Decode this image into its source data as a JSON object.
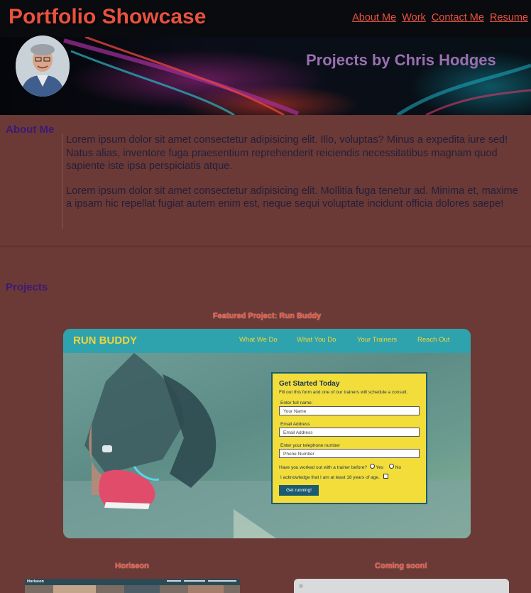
{
  "header": {
    "site_title": "Portfolio Showcase",
    "nav": [
      "About Me",
      "Work",
      "Contact Me",
      "Resume"
    ]
  },
  "hero": {
    "title": "Projects by Chris Hodges"
  },
  "about": {
    "heading": "About Me",
    "paragraphs": [
      "Lorem ipsum dolor sit amet consectetur adipisicing elit. Illo, voluptas? Minus a expedita iure sed! Natus alias, inventore fuga praesentium reprehenderit reiciendis necessitatibus magnam quod sapiente iste ipsa perspiciatis atque.",
      "Lorem ipsum dolor sit amet consectetur adipisicing elit. Mollitia fuga tenetur ad. Minima et, maxime a ipsam hic repellat fugiat autem enim est, neque sequi voluptate incidunt officia dolores saepe!"
    ]
  },
  "projects": {
    "heading": "Projects",
    "featured": {
      "caption": "Featured Project: Run Buddy",
      "logo": "RUN BUDDY",
      "nav": [
        "What We Do",
        "What You Do",
        "Your Trainers",
        "Reach Out"
      ],
      "form": {
        "title": "Get Started Today",
        "subtitle": "Fill out this form and one of our trainers will schedule a consult.",
        "name_label": "Enter full name:",
        "name_placeholder": "Your Name",
        "email_label": "Email Address",
        "email_placeholder": "Email Address",
        "phone_label": "Enter your telephone number",
        "phone_placeholder": "Phone Number",
        "question": "Have you worked out with a trainer before?",
        "yes": "Yes",
        "no": "No",
        "ack": "I acknowledge that I am at least 18 years of age.",
        "button": "Get running!"
      }
    },
    "secondary": [
      {
        "caption": "Horiseon",
        "thumb_title": "Horiseon"
      },
      {
        "caption": "Coming soon!"
      }
    ]
  }
}
